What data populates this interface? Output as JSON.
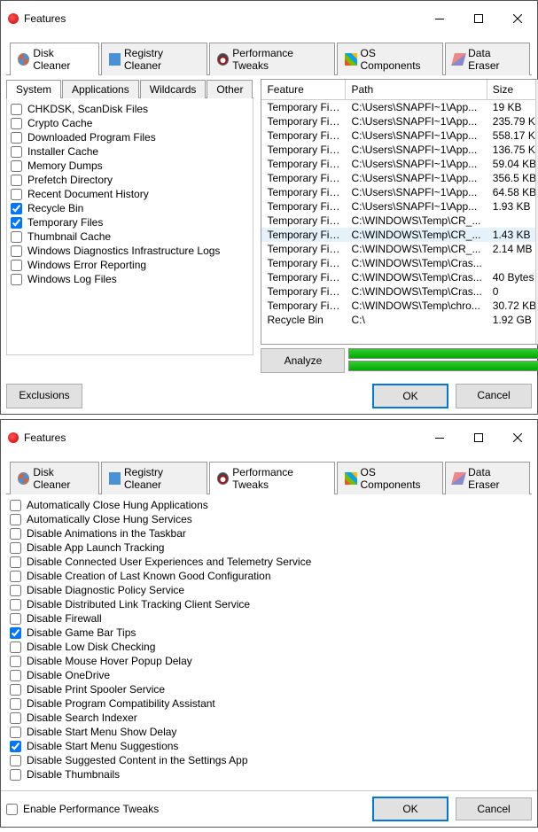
{
  "window1": {
    "title": "Features",
    "tabs": [
      "Disk Cleaner",
      "Registry Cleaner",
      "Performance Tweaks",
      "OS Components",
      "Data Eraser"
    ],
    "subtabs": [
      "System",
      "Applications",
      "Wildcards",
      "Other"
    ],
    "checklist": [
      {
        "label": "CHKDSK, ScanDisk Files",
        "checked": false
      },
      {
        "label": "Crypto Cache",
        "checked": false
      },
      {
        "label": "Downloaded Program Files",
        "checked": false
      },
      {
        "label": "Installer Cache",
        "checked": false
      },
      {
        "label": "Memory Dumps",
        "checked": false
      },
      {
        "label": "Prefetch Directory",
        "checked": false
      },
      {
        "label": "Recent Document History",
        "checked": false
      },
      {
        "label": "Recycle Bin",
        "checked": true
      },
      {
        "label": "Temporary Files",
        "checked": true
      },
      {
        "label": "Thumbnail Cache",
        "checked": false
      },
      {
        "label": "Windows Diagnostics Infrastructure Logs",
        "checked": false
      },
      {
        "label": "Windows Error Reporting",
        "checked": false
      },
      {
        "label": "Windows Log Files",
        "checked": false
      }
    ],
    "table": {
      "headers": [
        "Feature",
        "Path",
        "Size"
      ],
      "rows": [
        {
          "feature": "Temporary Files",
          "path": "C:\\Users\\SNAPFI~1\\App...",
          "size": "19 KB"
        },
        {
          "feature": "Temporary Files",
          "path": "C:\\Users\\SNAPFI~1\\App...",
          "size": "235.79 KB"
        },
        {
          "feature": "Temporary Files",
          "path": "C:\\Users\\SNAPFI~1\\App...",
          "size": "558.17 KB"
        },
        {
          "feature": "Temporary Files",
          "path": "C:\\Users\\SNAPFI~1\\App...",
          "size": "136.75 KB"
        },
        {
          "feature": "Temporary Files",
          "path": "C:\\Users\\SNAPFI~1\\App...",
          "size": "59.04 KB"
        },
        {
          "feature": "Temporary Files",
          "path": "C:\\Users\\SNAPFI~1\\App...",
          "size": "356.5 KB"
        },
        {
          "feature": "Temporary Files",
          "path": "C:\\Users\\SNAPFI~1\\App...",
          "size": "64.58 KB"
        },
        {
          "feature": "Temporary Files",
          "path": "C:\\Users\\SNAPFI~1\\App...",
          "size": "1.93 KB"
        },
        {
          "feature": "Temporary Files",
          "path": "C:\\WINDOWS\\Temp\\CR_...",
          "size": ""
        },
        {
          "feature": "Temporary Files",
          "path": "C:\\WINDOWS\\Temp\\CR_...",
          "size": "1.43 KB",
          "sel": true
        },
        {
          "feature": "Temporary Files",
          "path": "C:\\WINDOWS\\Temp\\CR_...",
          "size": "2.14 MB"
        },
        {
          "feature": "Temporary Files",
          "path": "C:\\WINDOWS\\Temp\\Cras...",
          "size": ""
        },
        {
          "feature": "Temporary Files",
          "path": "C:\\WINDOWS\\Temp\\Cras...",
          "size": "40 Bytes"
        },
        {
          "feature": "Temporary Files",
          "path": "C:\\WINDOWS\\Temp\\Cras...",
          "size": "0"
        },
        {
          "feature": "Temporary Files",
          "path": "C:\\WINDOWS\\Temp\\chro...",
          "size": "30.72 KB"
        },
        {
          "feature": "Recycle Bin",
          "path": "C:\\",
          "size": "1.92 GB"
        }
      ]
    },
    "analyze_label": "Analyze",
    "exclusions_label": "Exclusions",
    "ok_label": "OK",
    "cancel_label": "Cancel"
  },
  "window2": {
    "title": "Features",
    "tabs": [
      "Disk Cleaner",
      "Registry Cleaner",
      "Performance Tweaks",
      "OS Components",
      "Data Eraser"
    ],
    "checklist": [
      {
        "label": "Automatically Close Hung Applications",
        "checked": false
      },
      {
        "label": "Automatically Close Hung Services",
        "checked": false
      },
      {
        "label": "Disable Animations in the Taskbar",
        "checked": false
      },
      {
        "label": "Disable App Launch Tracking",
        "checked": false
      },
      {
        "label": "Disable Connected User Experiences and Telemetry Service",
        "checked": false
      },
      {
        "label": "Disable Creation of Last Known Good Configuration",
        "checked": false
      },
      {
        "label": "Disable Diagnostic Policy Service",
        "checked": false
      },
      {
        "label": "Disable Distributed Link Tracking Client Service",
        "checked": false
      },
      {
        "label": "Disable Firewall",
        "checked": false
      },
      {
        "label": "Disable Game Bar Tips",
        "checked": true
      },
      {
        "label": "Disable Low Disk Checking",
        "checked": false
      },
      {
        "label": "Disable Mouse Hover Popup Delay",
        "checked": false
      },
      {
        "label": "Disable OneDrive",
        "checked": false
      },
      {
        "label": "Disable Print Spooler Service",
        "checked": false
      },
      {
        "label": "Disable Program Compatibility Assistant",
        "checked": false
      },
      {
        "label": "Disable Search Indexer",
        "checked": false
      },
      {
        "label": "Disable Start Menu Show Delay",
        "checked": false
      },
      {
        "label": "Disable Start Menu Suggestions",
        "checked": true
      },
      {
        "label": "Disable Suggested Content in the Settings App",
        "checked": false
      },
      {
        "label": "Disable Thumbnails",
        "checked": false
      }
    ],
    "enable_label": "Enable Performance Tweaks",
    "ok_label": "OK",
    "cancel_label": "Cancel"
  }
}
